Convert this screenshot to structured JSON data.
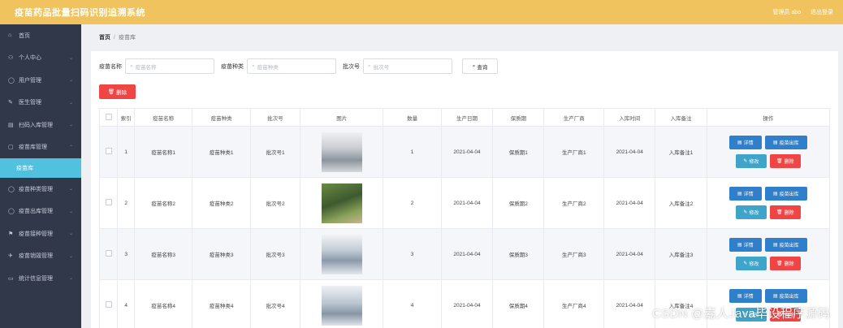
{
  "app": {
    "title": "疫苗药品批量扫码识别追溯系统",
    "user_label": "管理员 abo",
    "logout_label": "退出登录"
  },
  "sidebar": {
    "items": [
      {
        "icon": "⌂",
        "label": "首页"
      },
      {
        "icon": "⚇",
        "label": "个人中心"
      },
      {
        "icon": "◯",
        "label": "用户管理"
      },
      {
        "icon": "✎",
        "label": "医生管理"
      },
      {
        "icon": "▤",
        "label": "扫码入库管理"
      },
      {
        "icon": "▢",
        "label": "疫苗库管理"
      },
      {
        "icon": "",
        "label": "疫苗库"
      },
      {
        "icon": "◯",
        "label": "疫苗种类管理"
      },
      {
        "icon": "◯",
        "label": "疫苗出库管理"
      },
      {
        "icon": "⚑",
        "label": "疫苗接种管理"
      },
      {
        "icon": "✈",
        "label": "疫苗销毁管理"
      },
      {
        "icon": "▭",
        "label": "统计信息管理"
      }
    ]
  },
  "breadcrumb": {
    "home": "首页",
    "current": "疫苗库"
  },
  "search": {
    "name_label": "疫苗名称",
    "name_placeholder": "疫苗名称",
    "type_label": "疫苗种类",
    "type_placeholder": "疫苗种类",
    "batch_label": "批次号",
    "batch_placeholder": "批次号",
    "search_label": "查询"
  },
  "toolbar": {
    "delete_label": "删除"
  },
  "table": {
    "headers": [
      "索引",
      "疫苗名称",
      "疫苗种类",
      "批次号",
      "图片",
      "数量",
      "生产日期",
      "保质期",
      "生产厂商",
      "入库时间",
      "入库备注",
      "操作"
    ],
    "rows": [
      {
        "index": "1",
        "name": "疫苗名称1",
        "type": "疫苗种类1",
        "batch": "批次号1",
        "qty": "1",
        "date": "2021-04-04",
        "shelf": "保质期1",
        "maker": "生产厂商1",
        "in_time": "2021-04-04",
        "note": "入库备注1"
      },
      {
        "index": "2",
        "name": "疫苗名称2",
        "type": "疫苗种类2",
        "batch": "批次号2",
        "qty": "2",
        "date": "2021-04-04",
        "shelf": "保质期2",
        "maker": "生产厂商2",
        "in_time": "2021-04-04",
        "note": "入库备注2"
      },
      {
        "index": "3",
        "name": "疫苗名称3",
        "type": "疫苗种类3",
        "batch": "批次号3",
        "qty": "3",
        "date": "2021-04-04",
        "shelf": "保质期3",
        "maker": "生产厂商3",
        "in_time": "2021-04-04",
        "note": "入库备注3"
      },
      {
        "index": "4",
        "name": "疫苗名称4",
        "type": "疫苗种类4",
        "batch": "批次号4",
        "qty": "4",
        "date": "2021-04-04",
        "shelf": "保质期4",
        "maker": "生产厂商4",
        "in_time": "2021-04-04",
        "note": "入库备注4"
      }
    ],
    "actions": {
      "detail": "详情",
      "out": "疫苗出库",
      "edit": "修改",
      "delete": "删除"
    }
  },
  "watermark": "CSDN @嘉人Java毕设程序源码"
}
